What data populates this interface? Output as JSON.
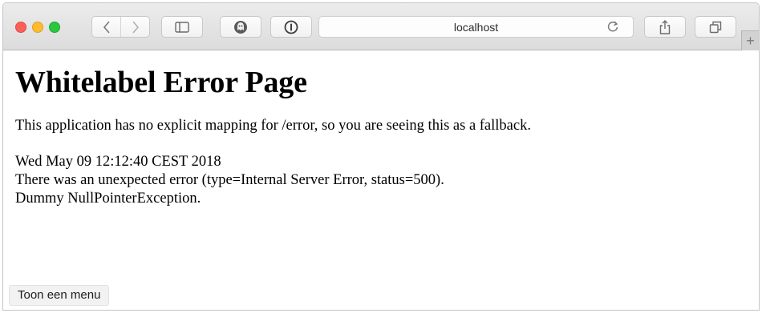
{
  "browser": {
    "url": "localhost",
    "new_tab_glyph": "+",
    "icons": {
      "back": "chevron-left-icon",
      "forward": "chevron-right-icon",
      "sidebar": "sidebar-icon",
      "extension1": "ghostery-icon",
      "extension2": "1password-icon",
      "reload": "reload-icon",
      "share": "share-icon",
      "tabs": "tabs-overview-icon"
    }
  },
  "page": {
    "title": "Whitelabel Error Page",
    "message": "This application has no explicit mapping for /error, so you are seeing this as a fallback.",
    "timestamp": "Wed May 09 12:12:40 CEST 2018",
    "error_line": "There was an unexpected error (type=Internal Server Error, status=500).",
    "exception": "Dummy NullPointerException."
  },
  "overlay": {
    "menu_label": "Toon een menu"
  }
}
